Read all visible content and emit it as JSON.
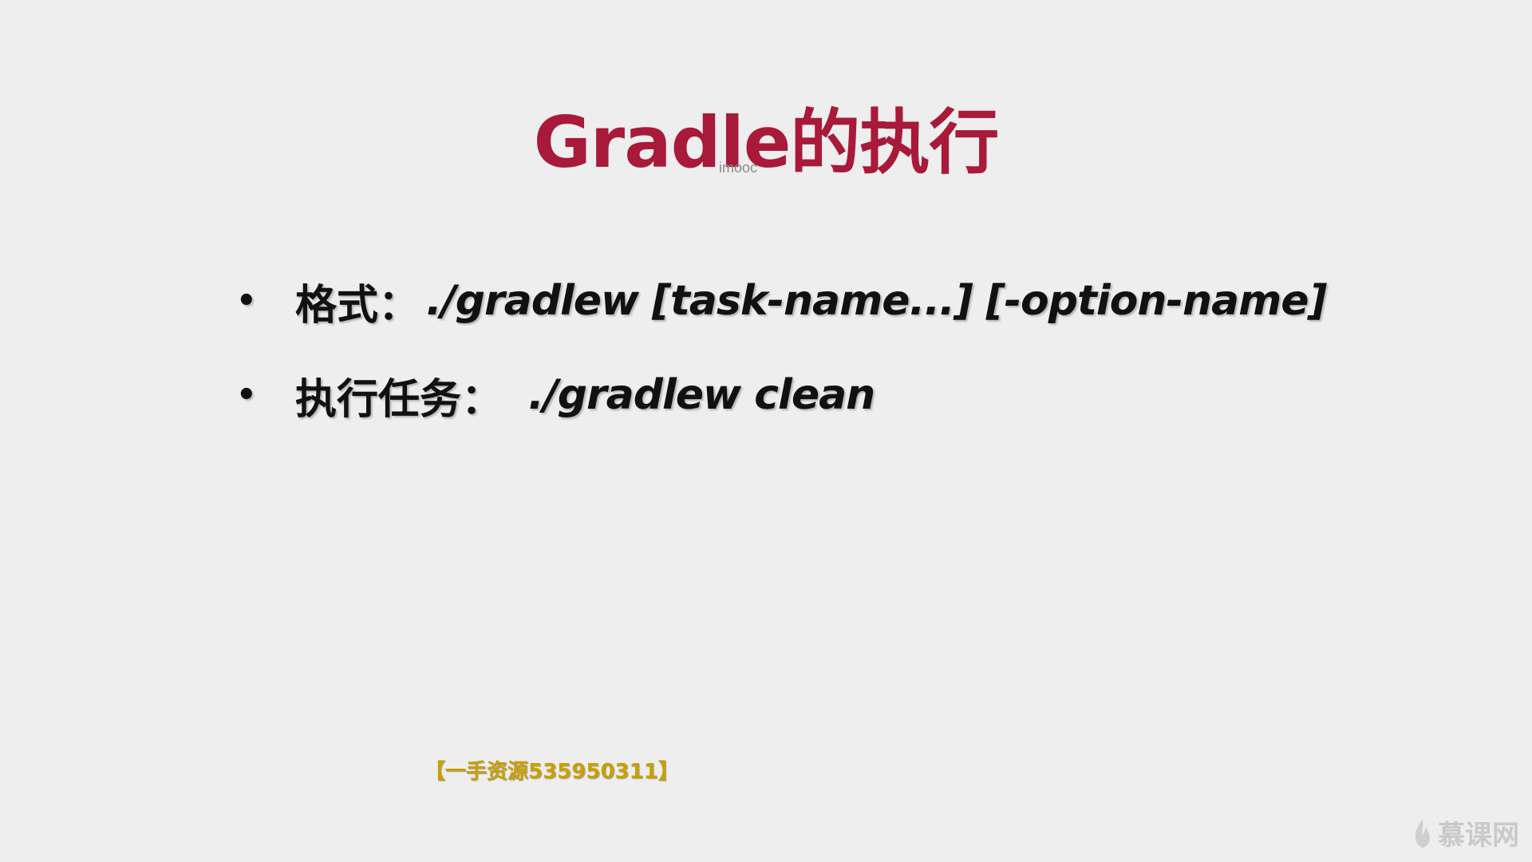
{
  "slide": {
    "title": "Gradle的执行",
    "watermark_text": "imooc",
    "bullets": [
      {
        "label": "格式：",
        "code": "./gradlew [task-name...] [-option-name]"
      },
      {
        "label": "执行任务：",
        "code": "./gradlew clean"
      }
    ],
    "resource_tag": "【一手资源535950311】",
    "brand_text": "慕课网",
    "brand_icon": "flame-icon"
  },
  "colors": {
    "background": "#eeeeee",
    "title": "#a8193a",
    "text": "#111111",
    "resource_tag": "#c9a000",
    "brand": "#c9c9c9"
  }
}
